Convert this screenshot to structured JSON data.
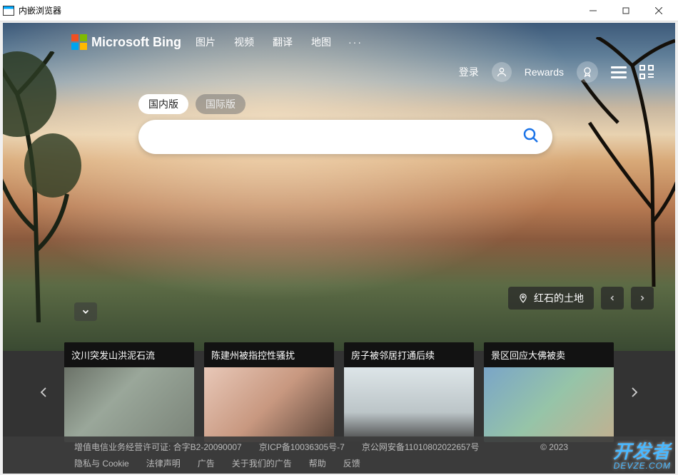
{
  "window": {
    "title": "内嵌浏览器"
  },
  "header": {
    "brand": "Microsoft Bing",
    "nav": [
      "图片",
      "视频",
      "翻译",
      "地图"
    ],
    "more": "···"
  },
  "user": {
    "login": "登录",
    "rewards": "Rewards"
  },
  "edition": {
    "domestic": "国内版",
    "international": "国际版"
  },
  "search": {
    "placeholder": ""
  },
  "location": {
    "label": "红石的土地"
  },
  "news": [
    {
      "title": "汶川突发山洪泥石流"
    },
    {
      "title": "陈建州被指控性骚扰"
    },
    {
      "title": "房子被邻居打通后续"
    },
    {
      "title": "景区回应大佛被卖"
    }
  ],
  "footer": {
    "row1": [
      "增值电信业务经营许可证: 合字B2-20090007",
      "京ICP备10036305号-7",
      "京公网安备11010802022657号"
    ],
    "row2": [
      "隐私与 Cookie",
      "法律声明",
      "广告",
      "关于我们的广告",
      "帮助",
      "反馈"
    ],
    "copyright": "© 2023"
  },
  "watermark": {
    "main": "开发者",
    "sub": "DEVZE.COM"
  }
}
